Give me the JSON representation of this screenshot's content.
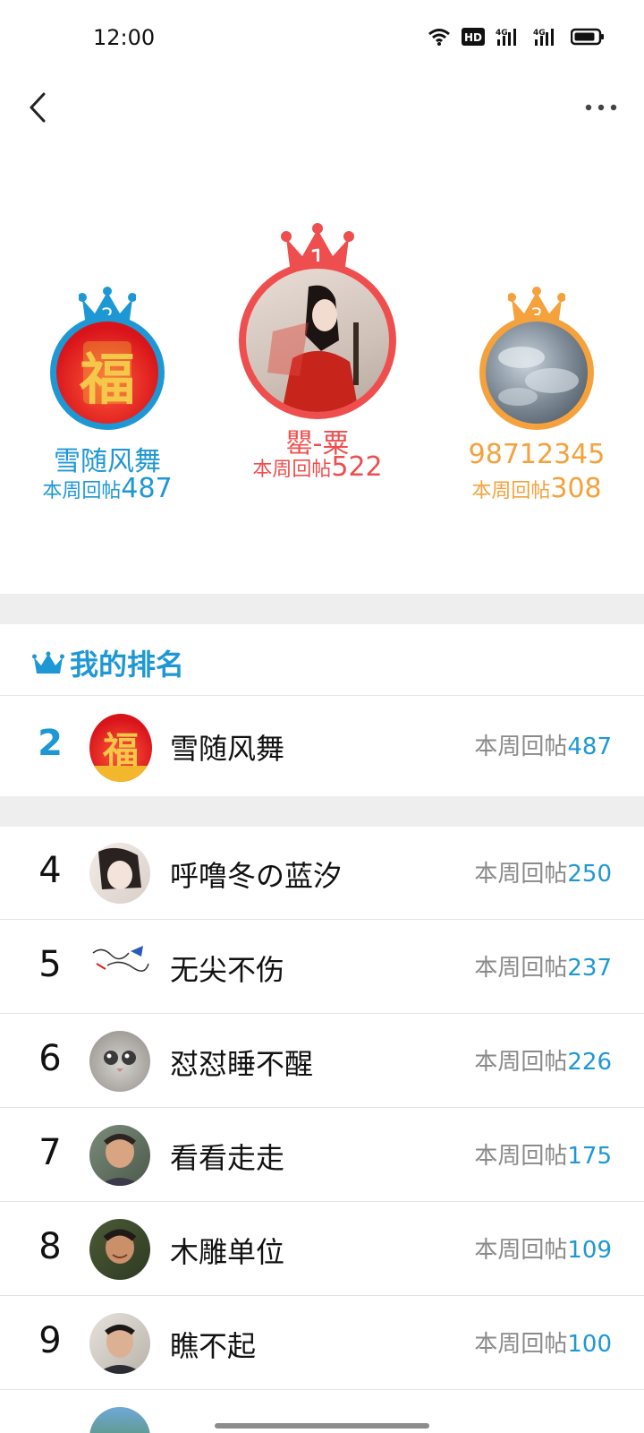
{
  "status": {
    "time": "12:00",
    "hd_label": "HD",
    "net1": "4G",
    "net2": "4G"
  },
  "icons": {
    "back": "chevron-left-icon",
    "more": "more-horizontal-icon",
    "crown": "crown-icon"
  },
  "colors": {
    "accent_blue": "#1e98d4",
    "gold_red": "#ef4e4e",
    "bronze_orange": "#f5a13c",
    "gray_text": "#8a8a8a"
  },
  "podium": {
    "first": {
      "rank": "1",
      "name": "罌-粟",
      "score_label": "本周回帖",
      "score": "522"
    },
    "second": {
      "rank": "2",
      "name": "雪随风舞",
      "score_label": "本周回帖",
      "score": "487"
    },
    "third": {
      "rank": "3",
      "name": "98712345",
      "score_label": "本周回帖",
      "score": "308"
    }
  },
  "my_rank": {
    "title": "我的排名",
    "rank": "2",
    "name": "雪随风舞",
    "score_label": "本周回帖",
    "score": "487"
  },
  "list": [
    {
      "rank": "4",
      "name": "呼噜冬の蓝汐",
      "score_label": "本周回帖",
      "score": "250"
    },
    {
      "rank": "5",
      "name": "无尖不伤",
      "score_label": "本周回帖",
      "score": "237"
    },
    {
      "rank": "6",
      "name": "怼怼睡不醒",
      "score_label": "本周回帖",
      "score": "226"
    },
    {
      "rank": "7",
      "name": "看看走走",
      "score_label": "本周回帖",
      "score": "175"
    },
    {
      "rank": "8",
      "name": "木雕单位",
      "score_label": "本周回帖",
      "score": "109"
    },
    {
      "rank": "9",
      "name": "瞧不起",
      "score_label": "本周回帖",
      "score": "100"
    }
  ]
}
